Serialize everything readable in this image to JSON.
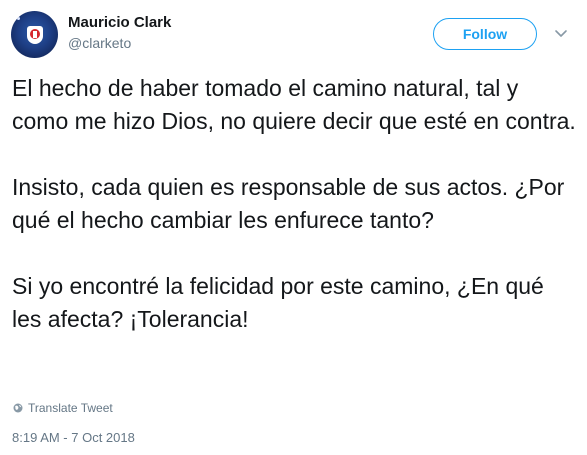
{
  "author": {
    "name": "Mauricio Clark",
    "handle": "@clarketo"
  },
  "follow_button": {
    "label": "Follow"
  },
  "menu": {
    "icon": "chevron-down-icon"
  },
  "tweet": {
    "paragraphs": [
      "El hecho de haber tomado el camino natural, tal y como me hizo Dios, no quiere decir que esté en contra.",
      "Insisto, cada quien es responsable de sus actos. ¿Por qué el hecho cambiar les enfurece tanto?",
      "Si yo encontré la felicidad por este camino, ¿En qué les afecta? ¡Tolerancia!"
    ]
  },
  "translate": {
    "label": "Translate Tweet",
    "icon": "globe-icon"
  },
  "timestamp": "8:19 AM - 7 Oct 2018",
  "colors": {
    "accent": "#1da1f2",
    "text": "#14171a",
    "secondary": "#657786"
  }
}
